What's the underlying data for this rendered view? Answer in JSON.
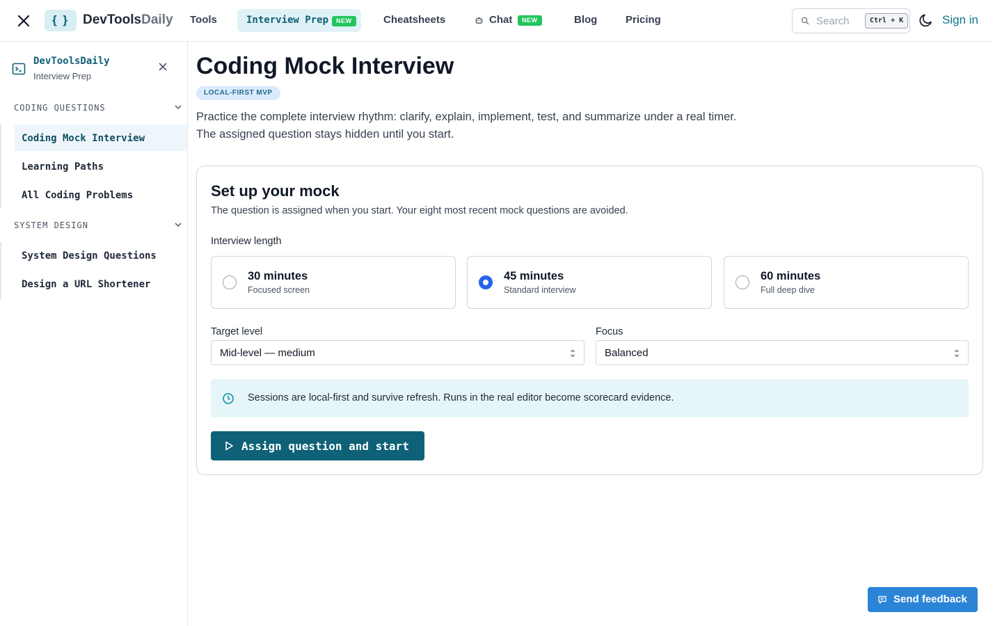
{
  "header": {
    "brand_main": "DevTools",
    "brand_light": "Daily",
    "logo_text": "{ }",
    "nav": {
      "tools": "Tools",
      "interview_prep": "Interview Prep",
      "cheatsheets": "Cheatsheets",
      "chat": "Chat",
      "blog": "Blog",
      "pricing": "Pricing"
    },
    "new_badge": "NEW",
    "search_placeholder": "Search",
    "search_shortcut": "Ctrl + K",
    "sign_in": "Sign in"
  },
  "sidebar": {
    "title": "DevToolsDaily",
    "subtitle": "Interview Prep",
    "groups": [
      {
        "label": "CODING QUESTIONS",
        "items": [
          "Coding Mock Interview",
          "Learning Paths",
          "All Coding Problems"
        ]
      },
      {
        "label": "SYSTEM DESIGN",
        "items": [
          "System Design Questions",
          "Design a URL Shortener"
        ]
      }
    ],
    "active_item": "Coding Mock Interview"
  },
  "main": {
    "title": "Coding Mock Interview",
    "badge": "LOCAL-FIRST MVP",
    "intro": "Practice the complete interview rhythm: clarify, explain, implement, test, and summarize under a real timer. The assigned question stays hidden until you start.",
    "card": {
      "heading": "Set up your mock",
      "subheading": "The question is assigned when you start. Your eight most recent mock questions are avoided.",
      "length_label": "Interview length",
      "options": [
        {
          "title": "30 minutes",
          "subtitle": "Focused screen",
          "selected": false
        },
        {
          "title": "45 minutes",
          "subtitle": "Standard interview",
          "selected": true
        },
        {
          "title": "60 minutes",
          "subtitle": "Full deep dive",
          "selected": false
        }
      ],
      "target_level_label": "Target level",
      "target_level_value": "Mid-level — medium",
      "focus_label": "Focus",
      "focus_value": "Balanced",
      "info_text": "Sessions are local-first and survive refresh. Runs in the real editor become scorecard evidence.",
      "start_button": "Assign question and start"
    }
  },
  "feedback_button": "Send feedback",
  "colors": {
    "accent": "#0e6177",
    "radio_selected": "#2563eb",
    "feedback": "#2b84d6",
    "new_badge": "#22c55e"
  },
  "icons": [
    "close-icon",
    "search-icon",
    "moon-icon",
    "terminal-icon",
    "chevron-down-icon",
    "clock-icon",
    "play-icon",
    "message-icon",
    "robot-icon"
  ]
}
